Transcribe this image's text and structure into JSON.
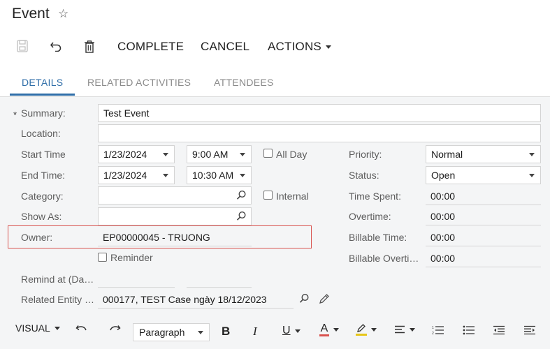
{
  "header": {
    "title": "Event"
  },
  "toolbar": {
    "complete_label": "COMPLETE",
    "cancel_label": "CANCEL",
    "actions_label": "ACTIONS"
  },
  "tabs": [
    {
      "label": "DETAILS",
      "active": true
    },
    {
      "label": "RELATED ACTIVITIES",
      "active": false
    },
    {
      "label": "ATTENDEES",
      "active": false
    }
  ],
  "form": {
    "required_mark": "*",
    "summary": {
      "label": "Summary:",
      "value": "Test Event"
    },
    "location": {
      "label": "Location:",
      "value": ""
    },
    "start_time": {
      "label": "Start Time",
      "date": "1/23/2024",
      "time": "9:00 AM"
    },
    "end_time": {
      "label": "End Time:",
      "date": "1/23/2024",
      "time": "10:30 AM"
    },
    "all_day": {
      "label": "All Day",
      "checked": false
    },
    "internal": {
      "label": "Internal",
      "checked": false
    },
    "category": {
      "label": "Category:",
      "value": ""
    },
    "show_as": {
      "label": "Show As:",
      "value": ""
    },
    "owner": {
      "label": "Owner:",
      "value": "EP00000045 - TRUONG"
    },
    "reminder": {
      "label": "Reminder",
      "checked": false
    },
    "remind_at": {
      "label": "Remind at (Da…"
    },
    "related_entity": {
      "label": "Related Entity …",
      "value": "000177, TEST Case ngày 18/12/2023"
    },
    "priority": {
      "label": "Priority:",
      "value": "Normal"
    },
    "status": {
      "label": "Status:",
      "value": "Open"
    },
    "time_spent": {
      "label": "Time Spent:",
      "value": "00:00"
    },
    "overtime": {
      "label": "Overtime:",
      "value": "00:00"
    },
    "billable_time": {
      "label": "Billable Time:",
      "value": "00:00"
    },
    "billable_overtime": {
      "label": "Billable Overti…",
      "value": "00:00"
    }
  },
  "editor": {
    "mode_label": "VISUAL",
    "format_value": "Paragraph",
    "bold": "B",
    "italic": "I",
    "underline": "U",
    "font_color": "A",
    "colors": {
      "font_color_bar": "#d9534f",
      "highlight_bar": "#e6c619"
    }
  },
  "colors": {
    "accent": "#2f6ea8",
    "highlight_border": "#d9534f"
  }
}
